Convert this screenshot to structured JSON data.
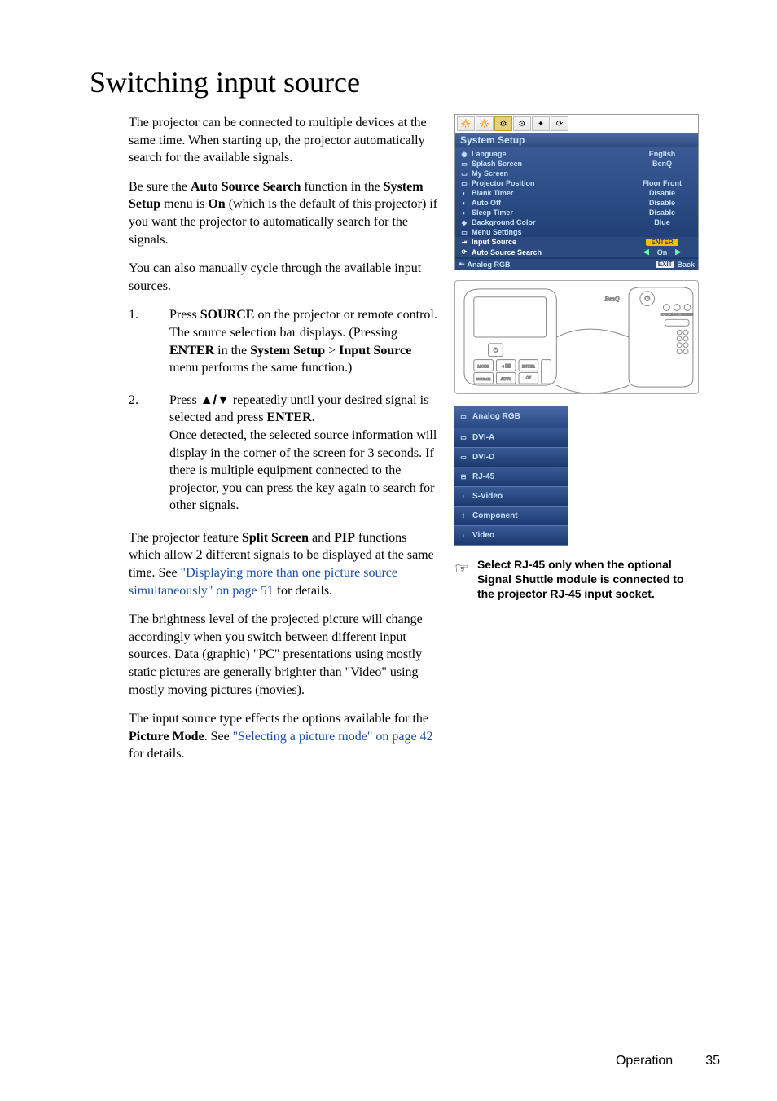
{
  "heading": "Switching input source",
  "p1": "The projector can be connected to multiple devices at the same time. When starting up, the projector automatically search for the available signals.",
  "p2_pre": "Be sure the ",
  "p2_b1": "Auto Source Search",
  "p2_mid1": " function in the ",
  "p2_b2": "System Setup",
  "p2_mid2": " menu is ",
  "p2_b3": "On",
  "p2_post": " (which is the default of this projector) if you want the projector to automatically search for the signals.",
  "p3": "You can also manually cycle through the available input sources.",
  "step1_num": "1.",
  "step1_a": "Press ",
  "step1_b1": "SOURCE",
  "step1_b": " on the projector or remote control. The source selection bar displays. (Pressing ",
  "step1_b2": "ENTER",
  "step1_c": " in the ",
  "step1_b3": "System Setup",
  "step1_d": " > ",
  "step1_b4": "Input Source",
  "step1_e": " menu performs the same function.)",
  "step2_num": "2.",
  "step2_a": "Press ",
  "step2_arrows": "▲/▼",
  "step2_b": " repeatedly until your desired signal is selected and press ",
  "step2_b1": "ENTER",
  "step2_c": ".",
  "step2_d": "Once detected, the selected source information will display in the corner of the screen for 3 seconds. If there is multiple equipment connected to the projector, you can press the key again to search for other signals.",
  "p4_a": "The projector feature ",
  "p4_b1": "Split Screen",
  "p4_b": " and ",
  "p4_b2": "PIP",
  "p4_c": " functions which allow 2 different signals to be displayed at the same time. See ",
  "p4_link": "\"Displaying more than one picture source simultaneously\" on page 51",
  "p4_d": " for details.",
  "p5": "The brightness level of the projected picture will change accordingly when you switch between different input sources. Data (graphic) \"PC\" presentations using mostly static pictures are generally brighter than \"Video\" using mostly moving pictures (movies).",
  "p6_a": "The input source type effects the options available for the ",
  "p6_b1": "Picture Mode",
  "p6_b": ". See ",
  "p6_link": "\"Selecting a picture mode\" on page 42",
  "p6_c": " for details.",
  "osd": {
    "title": "System Setup",
    "rows": [
      {
        "label": "Language",
        "value": "English"
      },
      {
        "label": "Splash Screen",
        "value": "BenQ"
      },
      {
        "label": "My Screen",
        "value": ""
      },
      {
        "label": "Projector Position",
        "value": "Floor Front"
      },
      {
        "label": "Blank Timer",
        "value": "Disable"
      },
      {
        "label": "Auto Off",
        "value": "Disable"
      },
      {
        "label": "Sleep Timer",
        "value": "Disable"
      },
      {
        "label": "Background Color",
        "value": "Blue"
      },
      {
        "label": "Menu Settings",
        "value": ""
      }
    ],
    "input_source_label": "Input Source",
    "enter_badge": "ENTER",
    "auto_src_label": "Auto Source Search",
    "auto_src_value": "On",
    "foot_label": "Analog RGB",
    "exit_badge": "EXIT",
    "back_label": "Back"
  },
  "src_items": [
    "Analog RGB",
    "DVI-A",
    "DVI-D",
    "RJ-45",
    "S-Video",
    "Component",
    "Video"
  ],
  "note_text": "Select RJ-45 only when the optional Signal Shuttle module is connected to the projector RJ-45 input socket.",
  "footer_section": "Operation",
  "footer_page": "35"
}
